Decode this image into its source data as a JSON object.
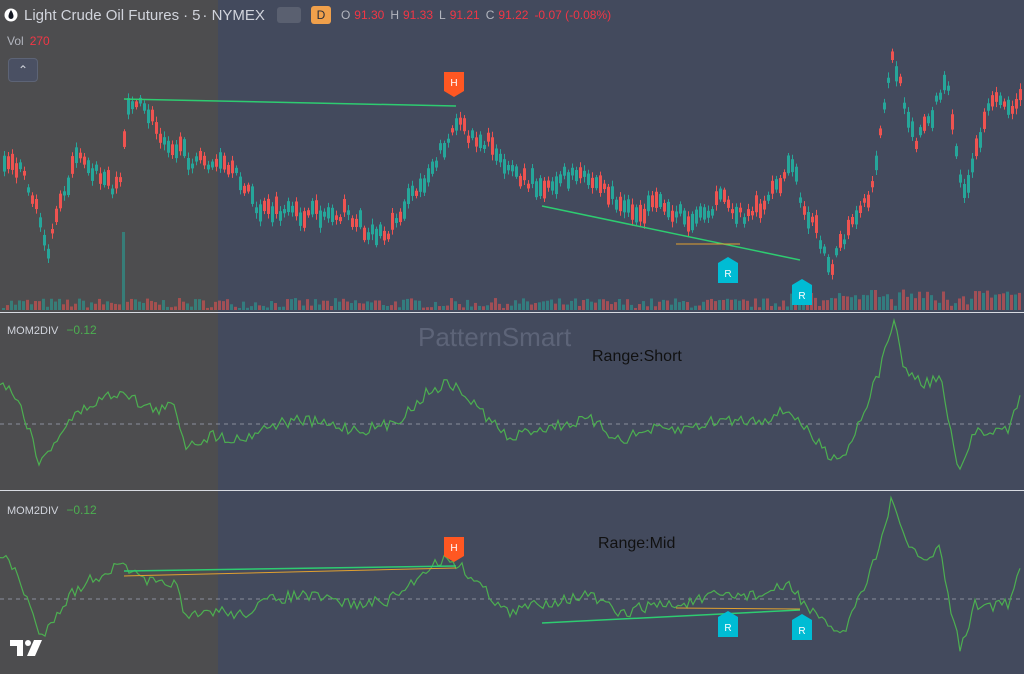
{
  "header": {
    "title": "Light Crude Oil Futures",
    "separator": "·",
    "interval": "5",
    "exchange": "· NYMEX",
    "d_badge": "D",
    "ohlc": [
      {
        "k": "O",
        "v": "91.30"
      },
      {
        "k": "H",
        "v": "91.33"
      },
      {
        "k": "L",
        "v": "91.21"
      },
      {
        "k": "C",
        "v": "91.22"
      }
    ],
    "change": "-0.07 (-0.08%)"
  },
  "volume": {
    "label": "Vol",
    "value": "270"
  },
  "indicator1": {
    "name": "MOM2DIV",
    "value": "−0.12",
    "range_label": "Range:Short"
  },
  "indicator2": {
    "name": "MOM2DIV",
    "value": "−0.12",
    "range_label": "Range:Mid"
  },
  "watermark": "PatternSmart",
  "markers": {
    "high": "H",
    "reversal": "R"
  },
  "icons": {
    "symbol": "drop-icon",
    "collapse": "chevron-up-icon",
    "logo": "tradingview-logo"
  },
  "colors": {
    "background": "#434a5d",
    "session_shade": "#4d4d4f",
    "up": "#26a69a",
    "down": "#ef5350",
    "momentum": "#4caf50",
    "trendline": "#2ecc71",
    "trendline_alt": "#e0a030",
    "marker_high": "#ff5722",
    "marker_reversal": "#00bcd4"
  }
}
